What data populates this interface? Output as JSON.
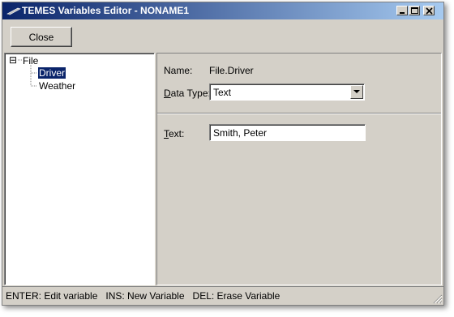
{
  "window": {
    "title": "TEMES Variables Editor - NONAME1"
  },
  "toolbar": {
    "close_label": "Close"
  },
  "tree": {
    "root": {
      "label": "File",
      "expander": "⊟"
    },
    "items": [
      {
        "label": "Driver",
        "selected": true
      },
      {
        "label": "Weather",
        "selected": false
      }
    ]
  },
  "details": {
    "name_label": "Name:",
    "name_value": "File.Driver",
    "datatype_label_key": "D",
    "datatype_label_rest": "ata Type:",
    "datatype_value": "Text",
    "text_label_key": "T",
    "text_label_rest": "ext:",
    "text_value": "Smith, Peter"
  },
  "status": {
    "text": "ENTER: Edit variable   INS: New Variable   DEL: Erase Variable"
  },
  "icons": {
    "app": "pen-icon",
    "minimize": "minimize-icon",
    "maximize": "maximize-icon",
    "close": "close-icon",
    "dropdown": "chevron-down-icon",
    "grip": "resize-grip-icon"
  },
  "colors": {
    "title_start": "#0a246a",
    "title_end": "#a6caf0",
    "face": "#d4d0c8",
    "selection": "#0a246a"
  }
}
